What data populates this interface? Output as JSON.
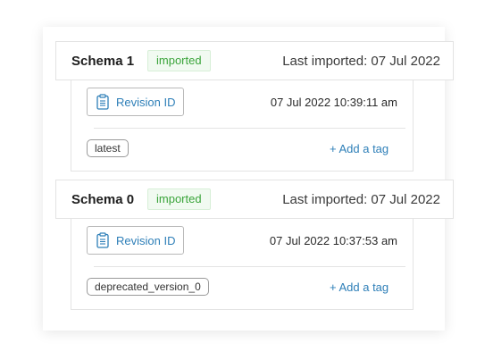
{
  "schemas": [
    {
      "name": "Schema 1",
      "status": "imported",
      "last_imported": "Last imported: 07 Jul 2022",
      "revision_button": "Revision ID",
      "timestamp": "07 Jul 2022 10:39:11 am",
      "tag": "latest",
      "add_tag": "+ Add a tag"
    },
    {
      "name": "Schema 0",
      "status": "imported",
      "last_imported": "Last imported: 07 Jul 2022",
      "revision_button": "Revision ID",
      "timestamp": "07 Jul 2022 10:37:53 am",
      "tag": "deprecated_version_0",
      "add_tag": "+ Add a tag"
    }
  ],
  "colors": {
    "accent": "#2e7fb8",
    "status_green": "#3aa43a",
    "border": "#e3e3e3"
  },
  "icons": {
    "revision": "clipboard-icon"
  }
}
